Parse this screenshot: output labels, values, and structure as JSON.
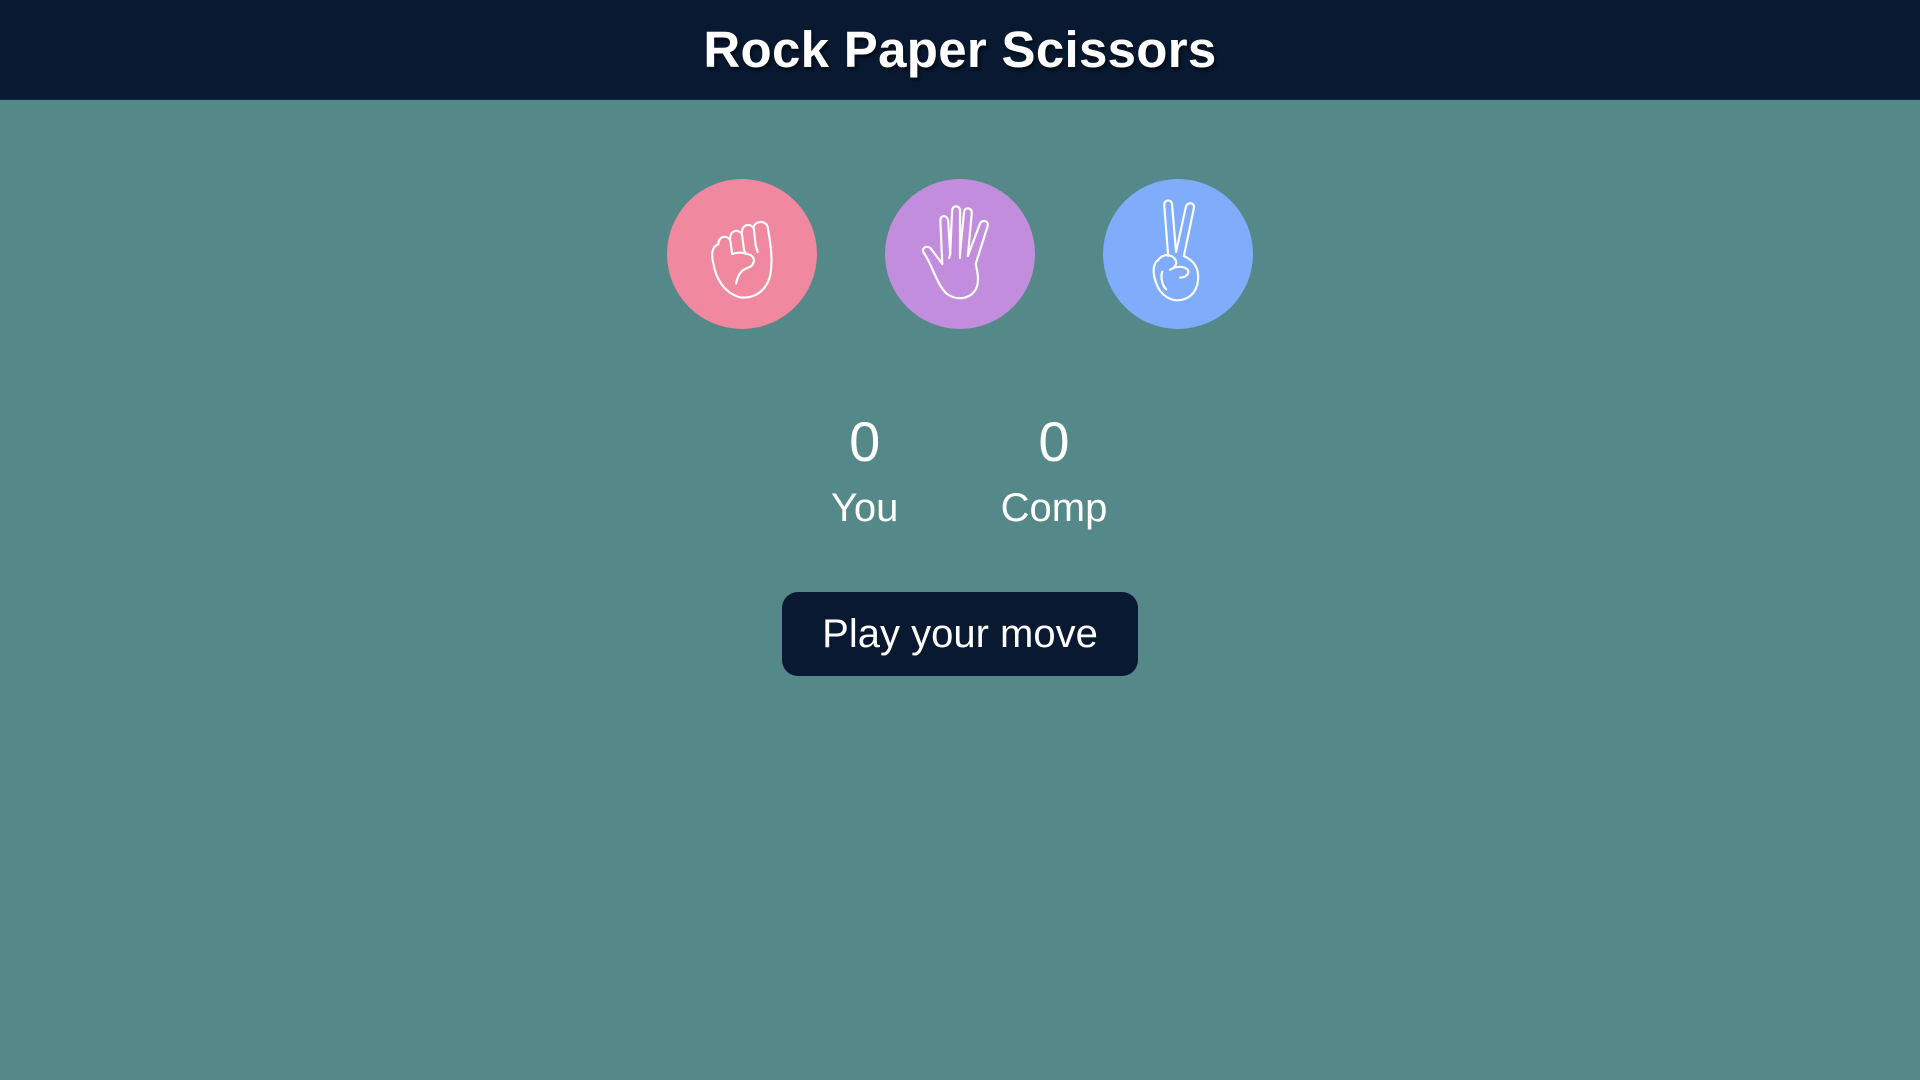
{
  "header": {
    "title": "Rock Paper Scissors"
  },
  "choices": [
    {
      "id": "rock",
      "icon": "rock-fist-icon",
      "color": "#f0889f"
    },
    {
      "id": "paper",
      "icon": "paper-open-hand-icon",
      "color": "#c38ddd"
    },
    {
      "id": "scissors",
      "icon": "scissors-peace-hand-icon",
      "color": "#80acfc"
    }
  ],
  "scoreboard": {
    "user": {
      "score": "0",
      "label": "You"
    },
    "comp": {
      "score": "0",
      "label": "Comp"
    }
  },
  "message": {
    "text": "Play your move",
    "color": "#081931"
  },
  "colors": {
    "background": "#558888",
    "header": "#081931",
    "text": "#ffffff"
  }
}
